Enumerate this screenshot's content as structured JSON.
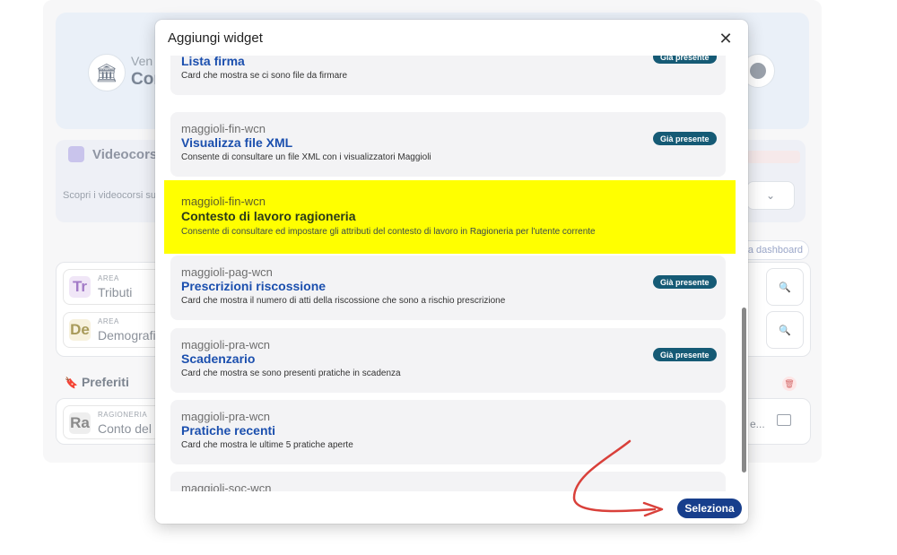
{
  "background": {
    "hero": {
      "line1": "Ven",
      "line2": "Cor"
    },
    "video": {
      "title": "Videocorsi",
      "description": "Scopri i videocorsi su"
    },
    "dashboard_link": "a dashboard",
    "areas": [
      {
        "small": "AREA",
        "name": "Tributi",
        "badge": "Tr",
        "color": "#f0e6f7",
        "text_color": "#a27ac7"
      },
      {
        "small": "AREA",
        "name": "Demografi",
        "badge": "De",
        "color": "#f7f1dd",
        "text_color": "#a89a5a"
      }
    ],
    "favorites": {
      "title": "Preferiti",
      "card": {
        "small": "RAGIONERIA",
        "name": "Conto del",
        "badge": "Ra",
        "color": "#eeeeee",
        "text_color": "#8a8a8a"
      },
      "right_text": "e..."
    }
  },
  "modal": {
    "title": "Aggiungi widget",
    "close_glyph": "✕",
    "select_label": "Seleziona",
    "present_label": "Già presente",
    "widgets": [
      {
        "source": "maggioli-doc-wcn",
        "title": "Lista firma",
        "description": "Card che mostra se ci sono file da firmare",
        "present": true,
        "selected": false
      },
      {
        "source": "maggioli-fin-wcn",
        "title": "Visualizza file XML",
        "description": "Consente di consultare un file XML con i visualizzatori Maggioli",
        "present": true,
        "selected": false
      },
      {
        "source": "maggioli-fin-wcn",
        "title": "Contesto di lavoro ragioneria",
        "description": "Consente di consultare ed impostare gli attributi del contesto di lavoro in Ragioneria per l'utente corrente",
        "present": false,
        "selected": true
      },
      {
        "source": "maggioli-pag-wcn",
        "title": "Prescrizioni riscossione",
        "description": "Card che mostra il numero di atti della riscossione che sono a rischio prescrizione",
        "present": true,
        "selected": false
      },
      {
        "source": "maggioli-pra-wcn",
        "title": "Scadenzario",
        "description": "Card che mostra se sono presenti pratiche in scadenza",
        "present": true,
        "selected": false
      },
      {
        "source": "maggioli-pra-wcn",
        "title": "Pratiche recenti",
        "description": "Card che mostra le ultime 5 pratiche aperte",
        "present": false,
        "selected": false
      },
      {
        "source": "maggioli-soc-wcn",
        "title": "",
        "description": "",
        "present": false,
        "selected": false
      }
    ]
  },
  "colors": {
    "highlight": "#ffff00",
    "primary": "#173e8c",
    "badge": "#155a75",
    "title": "#1b4fae",
    "arrow": "#d9403a"
  }
}
